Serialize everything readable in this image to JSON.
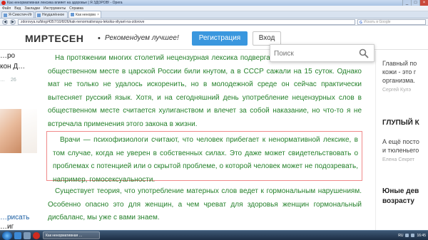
{
  "window": {
    "title": "Как ненормативная лексика влияет на здоровье | Я ЗДОРОВ! - Opera",
    "controls": [
      "_",
      "□",
      "×"
    ]
  },
  "menu": [
    "Файл",
    "Вид",
    "Закладки",
    "Инструменты",
    "Справка"
  ],
  "tabs": [
    {
      "label": "Я-Сиюстич-Игоря Его…"
    },
    {
      "label": "Неудалённое"
    },
    {
      "label": "Как ненормативная лекс…"
    }
  ],
  "address": {
    "back": "◀",
    "forward": "▶",
    "url": "zdorovya.ru/blog/4357/10/8/26/kak-nenormativnaya-leksika-vliyaet-na-zdorove",
    "search_placeholder": "Искать в Google",
    "search_engine": "G"
  },
  "header": {
    "logo": "МИРТЕСЕН",
    "separator": "•",
    "slogan": "Рекомендуем лучшее!",
    "register_label": "Регистрация",
    "login_label": "Вход",
    "search_placeholder": "Поиск"
  },
  "left_column": {
    "line1": "…ро",
    "line2": "кон Д…",
    "meta_text": "…",
    "meta_count": "26",
    "bottom_line1": "…рисать",
    "bottom_line2": "…иг"
  },
  "article": {
    "p1": "На протяжении многих столетий нецензурная лексика подвергалась гонениям, за ругань в общественном месте в царской России били кнутом, а в СССР сажали на 15 суток. Однако мат не только не удалось искоренить, но в молодежной среде он сейчас практически вытесняет русский язык. Хотя, и на сегодняшний день употребление нецензурных слов в общественном месте считается хулиганством и влечет за собой наказание, но что-то я не встречала применения этого закона в жизни.",
    "p2": "Врачи — психофизиологи считают, что человек прибегает к ненормативной лексике, в том случае, когда не уверен в собственных силах. Это даже может свидетельствовать о проблемах с потенцией или о скрытой проблеме, о которой человек может не подозревать, например, гомосексуальности.",
    "p3": "Существует теория, что употребление матерных слов ведет к гормональным нарушениям. Особенно опасно это для женщин, а чем чреват для здоровья женщин гормональный дисбаланс, мы уже с вами знаем."
  },
  "right_column": {
    "block1_lines": [
      "Главный по",
      "кожи - это г",
      "организма."
    ],
    "block1_meta": "Сергей Кулэ",
    "block2_title": "ГЛУПЫЙ К",
    "block2_lines": [
      "А ещё посто",
      "и тюленьего"
    ],
    "block2_meta": "Елена Секрет",
    "block3_lines": [
      "Юные дев",
      "возрасту"
    ]
  },
  "taskbar": {
    "app_label": "Как ненормативная …",
    "lang": "RU",
    "clock": "16:45"
  }
}
